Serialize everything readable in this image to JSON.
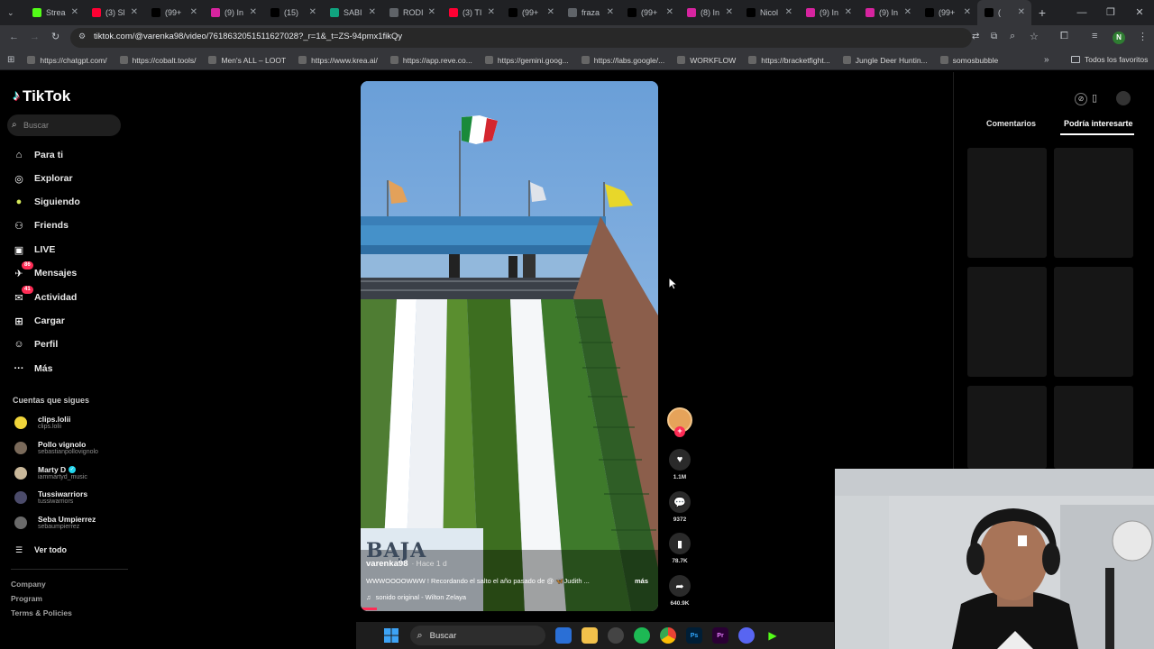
{
  "browser": {
    "tabs": [
      {
        "label": "Strea",
        "icon": "green-k-icon",
        "color": "#53fc18"
      },
      {
        "label": "(3) Sl",
        "icon": "youtube-icon",
        "color": "#ff0033"
      },
      {
        "label": "(99+",
        "icon": "tiktok-icon",
        "color": "#000000"
      },
      {
        "label": "(9) In",
        "icon": "instagram-icon",
        "color": "#d6249f"
      },
      {
        "label": "(15) ",
        "icon": "x-icon",
        "color": "#000000"
      },
      {
        "label": "SABI",
        "icon": "chatgpt-icon",
        "color": "#10a37f"
      },
      {
        "label": "RODI",
        "icon": "globe-icon",
        "color": "#5f6368"
      },
      {
        "label": "(3) TI",
        "icon": "youtube-icon",
        "color": "#ff0033"
      },
      {
        "label": "(99+",
        "icon": "tiktok-icon",
        "color": "#000000"
      },
      {
        "label": "fraza",
        "icon": "globe-icon",
        "color": "#5f6368"
      },
      {
        "label": "(99+",
        "icon": "tiktok-icon",
        "color": "#000000"
      },
      {
        "label": "(8) In",
        "icon": "instagram-icon",
        "color": "#d6249f"
      },
      {
        "label": "Nicol",
        "icon": "tiktok-icon",
        "color": "#000000"
      },
      {
        "label": "(9) In",
        "icon": "instagram-icon",
        "color": "#d6249f"
      },
      {
        "label": "(9) In",
        "icon": "instagram-icon",
        "color": "#d6249f"
      },
      {
        "label": "(99+",
        "icon": "tiktok-icon",
        "color": "#000000"
      },
      {
        "label": "(",
        "icon": "tiktok-icon",
        "color": "#000000",
        "active": true
      }
    ],
    "url": "tiktok.com/@varenka98/video/7618632051511627028?_r=1&_t=ZS-94pmx1fikQy",
    "bookmarks": [
      "https://chatgpt.com/",
      "https://cobalt.tools/",
      "Men's ALL – LOOT",
      "https://www.krea.ai/",
      "https://app.reve.co...",
      "https://gemini.goog...",
      "https://labs.google/...",
      "WORKFLOW",
      "https://bracketfight...",
      "Jungle Deer Huntin...",
      "somosbubble"
    ],
    "all_bookmarks": "Todos los favoritos"
  },
  "tiktok": {
    "logo": "TikTok",
    "search_placeholder": "Buscar",
    "nav": [
      {
        "label": "Para ti",
        "icon": "home-icon"
      },
      {
        "label": "Explorar",
        "icon": "compass-icon"
      },
      {
        "label": "Siguiendo",
        "icon": "following-icon"
      },
      {
        "label": "Friends",
        "icon": "friends-icon"
      },
      {
        "label": "LIVE",
        "icon": "live-icon"
      },
      {
        "label": "Mensajes",
        "icon": "messages-icon",
        "badge": "86"
      },
      {
        "label": "Actividad",
        "icon": "activity-icon",
        "badge": "41"
      },
      {
        "label": "Cargar",
        "icon": "upload-icon"
      },
      {
        "label": "Perfil",
        "icon": "profile-icon"
      },
      {
        "label": "Más",
        "icon": "more-icon"
      }
    ],
    "following_title": "Cuentas que sigues",
    "following": [
      {
        "name": "clips.lolii",
        "handle": "clips.lolii"
      },
      {
        "name": "Pollo vignolo",
        "handle": "sebastianpollovignolo"
      },
      {
        "name": "Marty D",
        "handle": "iammartyd_music",
        "verified": true
      },
      {
        "name": "Tussiwarriors",
        "handle": "tussiwarriors"
      },
      {
        "name": "Seba Umpierrez",
        "handle": "sebaumpierrez"
      }
    ],
    "see_all": "Ver todo",
    "footer": [
      "Company",
      "Program",
      "Terms & Policies"
    ],
    "video": {
      "author": "varenka98",
      "time": "· Hace 1 d",
      "caption": "WWWOOOOWWW ! Recordando el salto el año pasado de @ 🦋Judith ...",
      "more": "más",
      "sound": "sonido original - Wilton Zelaya",
      "sign_text": "BAJA"
    },
    "actions": [
      {
        "icon": "heart-icon",
        "value": "1.1M"
      },
      {
        "icon": "comment-icon",
        "value": "9372"
      },
      {
        "icon": "bookmark-icon",
        "value": "78.7K"
      },
      {
        "icon": "share-icon",
        "value": "640.9K"
      }
    ],
    "panel_tabs": [
      "Comentarios",
      "Podría interesarte"
    ]
  },
  "taskbar": {
    "search": "Buscar"
  }
}
